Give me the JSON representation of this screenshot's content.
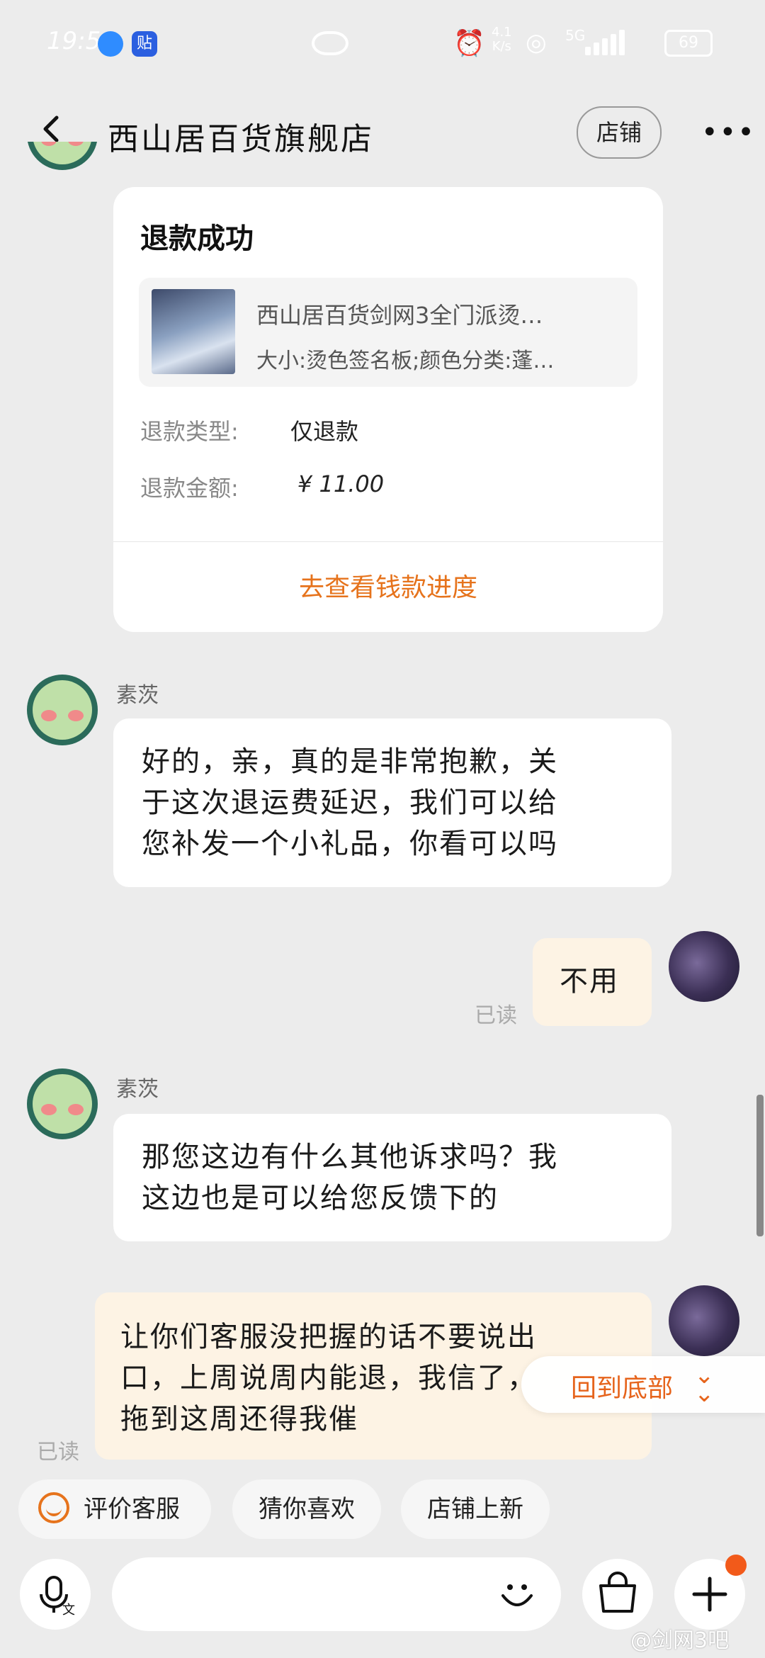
{
  "status_bar": {
    "time": "19:51",
    "app_badge": "贴",
    "net_speed_value": "4.1",
    "net_speed_unit": "K/s",
    "network": "5G",
    "battery": "69"
  },
  "header": {
    "title": "西山居百货旗舰店",
    "shop_button": "店铺",
    "more_icon": "more-icon"
  },
  "refund_card": {
    "title": "退款成功",
    "product_name": "西山居百货剑网3全门派烫…",
    "product_spec": "大小:烫色签名板;颜色分类:蓬…",
    "type_label": "退款类型:",
    "type_value": "仅退款",
    "amount_label": "退款金额:",
    "amount_value": "¥ 11.00",
    "progress_link": "去查看钱款进度"
  },
  "messages": [
    {
      "from": "cs",
      "sender": "素茨",
      "text_lines": [
        "好的，亲，真的是非常抱歉，关",
        "于这次退运费延迟，我们可以给",
        "您补发一个小礼品，你看可以吗"
      ]
    },
    {
      "from": "me",
      "text": "不用",
      "read": "已读"
    },
    {
      "from": "cs",
      "sender": "素茨",
      "text_lines": [
        "那您这边有什么其他诉求吗？我",
        "这边也是可以给您反馈下的"
      ]
    },
    {
      "from": "me",
      "text_lines": [
        "让你们客服没把握的话不要说出",
        "口，上周说周内能退，我信了，",
        "拖到这周还得我催"
      ],
      "read": "已读"
    }
  ],
  "back_to_bottom": "回到底部",
  "quick_chips": {
    "evaluate": "评价客服",
    "guess": "猜你喜欢",
    "new_items": "店铺上新"
  },
  "input": {
    "placeholder": ""
  },
  "watermark": "@剑网3吧",
  "colors": {
    "accent": "#e6731c",
    "background": "#ececec",
    "my_bubble": "#fdf3e4",
    "badge": "#f25a1a"
  }
}
